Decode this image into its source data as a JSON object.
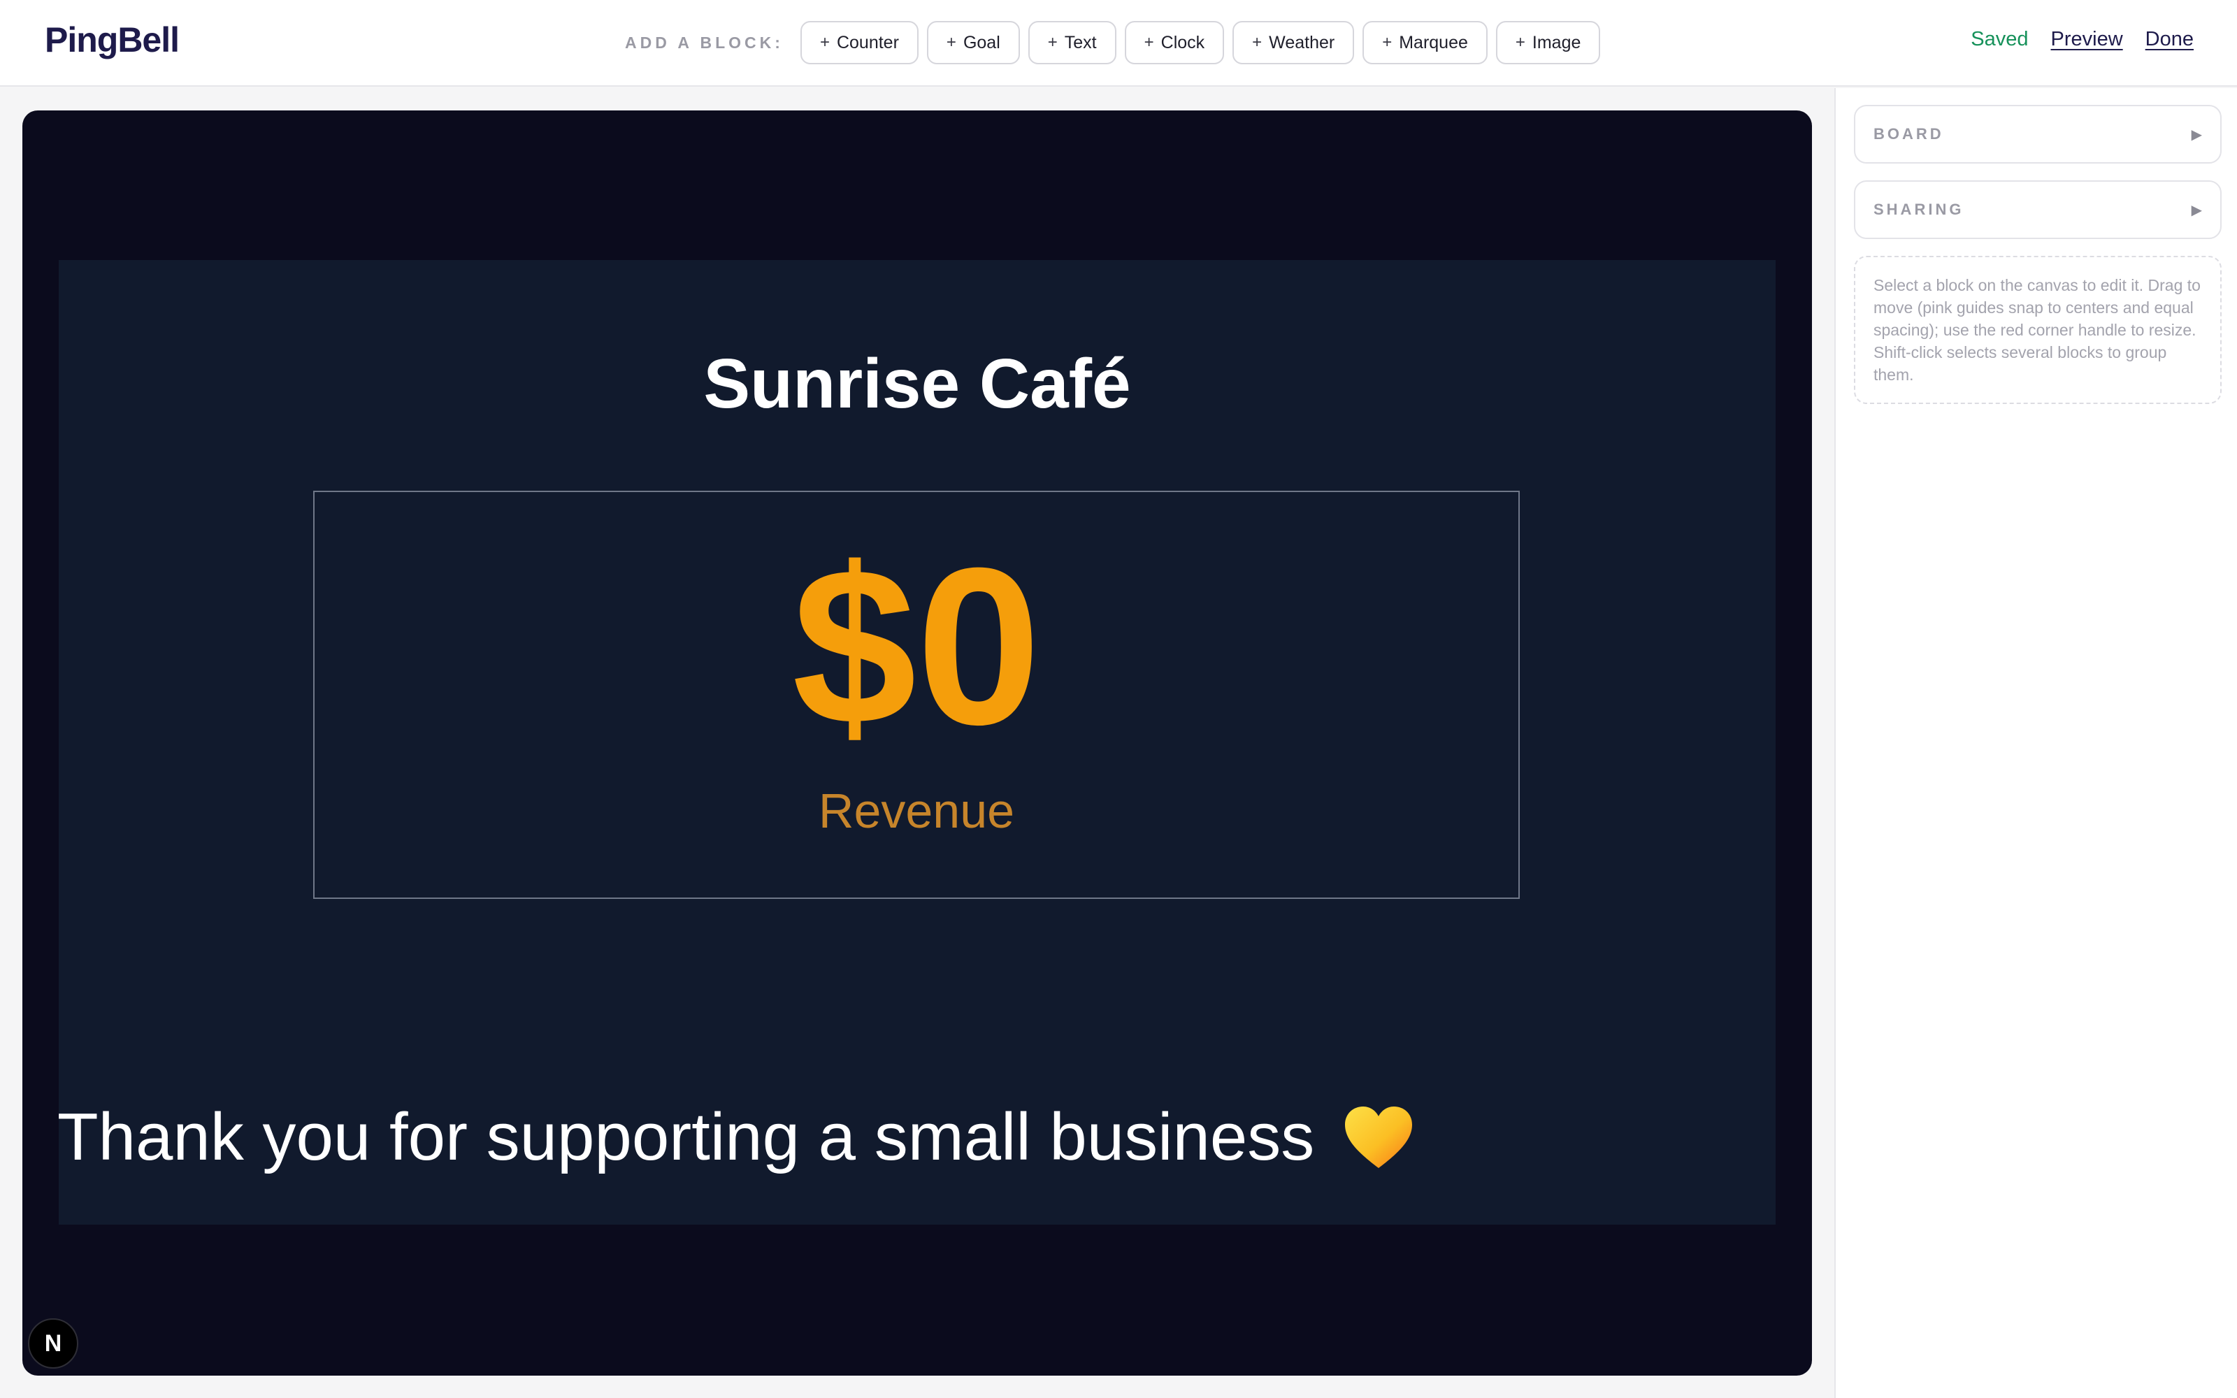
{
  "app": {
    "logo": "PingBell"
  },
  "toolbar": {
    "add_label": "ADD A BLOCK:",
    "blocks": [
      {
        "label": "Counter"
      },
      {
        "label": "Goal"
      },
      {
        "label": "Text"
      },
      {
        "label": "Clock"
      },
      {
        "label": "Weather"
      },
      {
        "label": "Marquee"
      },
      {
        "label": "Image"
      }
    ],
    "plus_glyph": "+"
  },
  "header_right": {
    "status": "Saved",
    "preview": "Preview",
    "done": "Done"
  },
  "board": {
    "title": "Sunrise Café",
    "counter": {
      "value": "$0",
      "label": "Revenue"
    },
    "marquee": "Thank you for supporting a small business",
    "marquee_icon": "heart-icon"
  },
  "badge": {
    "text": "N"
  },
  "panel": {
    "sections": [
      {
        "label": "BOARD",
        "arrow": "▶"
      },
      {
        "label": "SHARING",
        "arrow": "▶"
      }
    ],
    "hint": "Select a block on the canvas to edit it. Drag to move (pink guides snap to centers and equal spacing); use the red corner handle to resize. Shift-click selects several blocks to group them."
  },
  "colors": {
    "canvas_bg": "#0b0b1d",
    "board_bg": "#111a2d",
    "counter_accent": "#f59e0b",
    "saved_green": "#16915a",
    "brand": "#1e1b4b"
  }
}
